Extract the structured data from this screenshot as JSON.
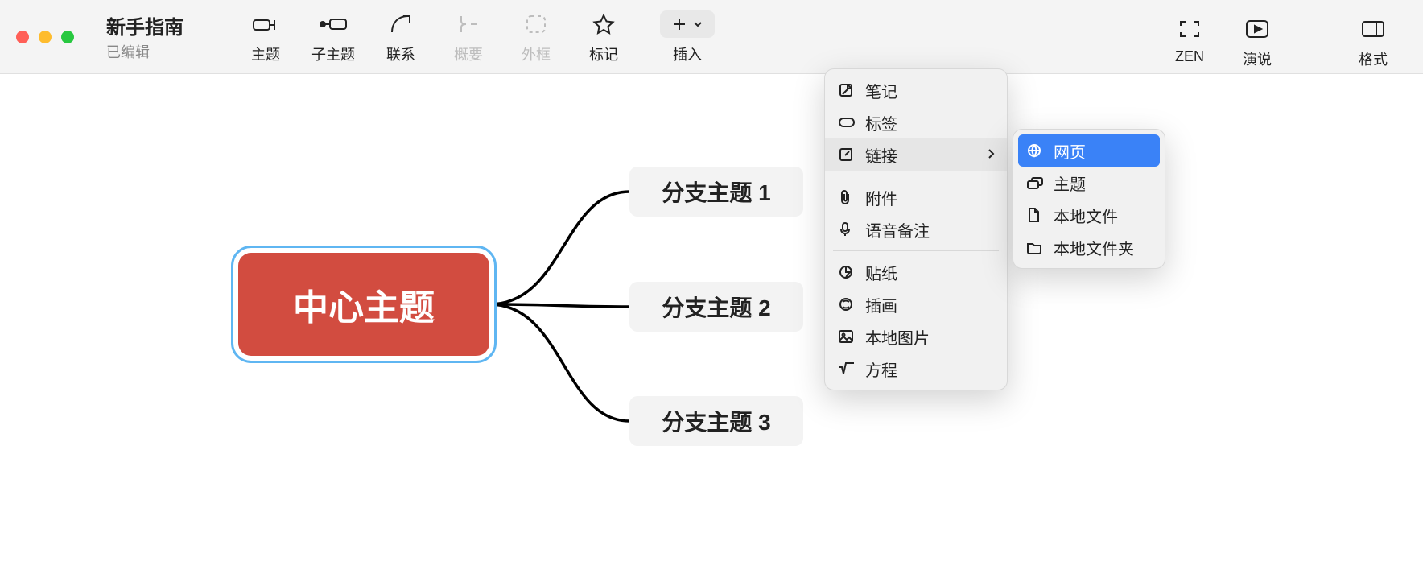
{
  "window": {
    "title": "新手指南",
    "subtitle": "已编辑"
  },
  "toolbar": {
    "topic": "主题",
    "subtopic": "子主题",
    "relation": "联系",
    "summary": "概要",
    "boundary": "外框",
    "marker": "标记",
    "insert": "插入",
    "zen": "ZEN",
    "present": "演说",
    "format": "格式"
  },
  "mindmap": {
    "central": "中心主题",
    "branches": [
      "分支主题 1",
      "分支主题 2",
      "分支主题 3"
    ]
  },
  "insert_menu": {
    "note": "笔记",
    "label": "标签",
    "link": "链接",
    "attachment": "附件",
    "voice": "语音备注",
    "sticker": "贴纸",
    "illustration": "插画",
    "local_image": "本地图片",
    "equation": "方程"
  },
  "link_submenu": {
    "web": "网页",
    "topic": "主题",
    "local_file": "本地文件",
    "local_folder": "本地文件夹"
  }
}
